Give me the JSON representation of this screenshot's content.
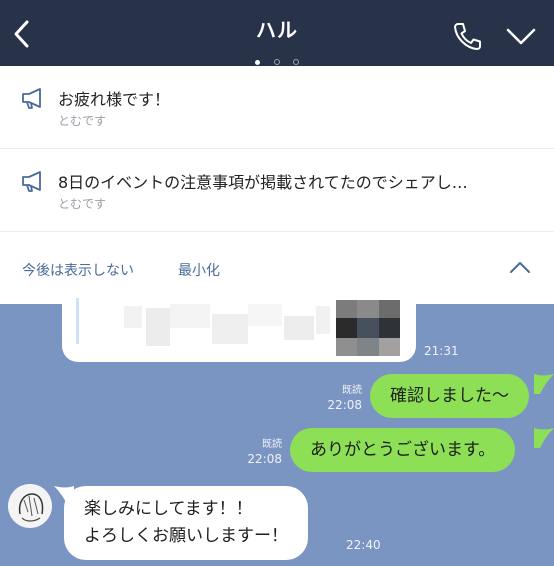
{
  "header": {
    "title": "ハル",
    "page_indicator": {
      "total": 3,
      "active_index": 0
    }
  },
  "announcements": [
    {
      "text": "お疲れ様です！",
      "author": "とむです"
    },
    {
      "text": "8日のイベントの注意事項が掲載されてたのでシェアし…",
      "author": "とむです"
    }
  ],
  "announcement_actions": {
    "dont_show": "今後は表示しない",
    "minimize": "最小化"
  },
  "messages": {
    "shared": {
      "time": "21:31"
    },
    "sent": [
      {
        "read": "既読",
        "time": "22:08",
        "text": "確認しました〜"
      },
      {
        "read": "既読",
        "time": "22:08",
        "text": "ありがとうございます。"
      }
    ],
    "received": {
      "lines": [
        "楽しみにしてます！！",
        "よろしくお願いしますー！"
      ],
      "time": "22:40"
    }
  },
  "colors": {
    "header_bg": "#283248",
    "chat_bg": "#7b95c2",
    "sent_bubble": "#8de055",
    "received_bubble": "#ffffff",
    "accent_link": "#4a6a9c"
  }
}
